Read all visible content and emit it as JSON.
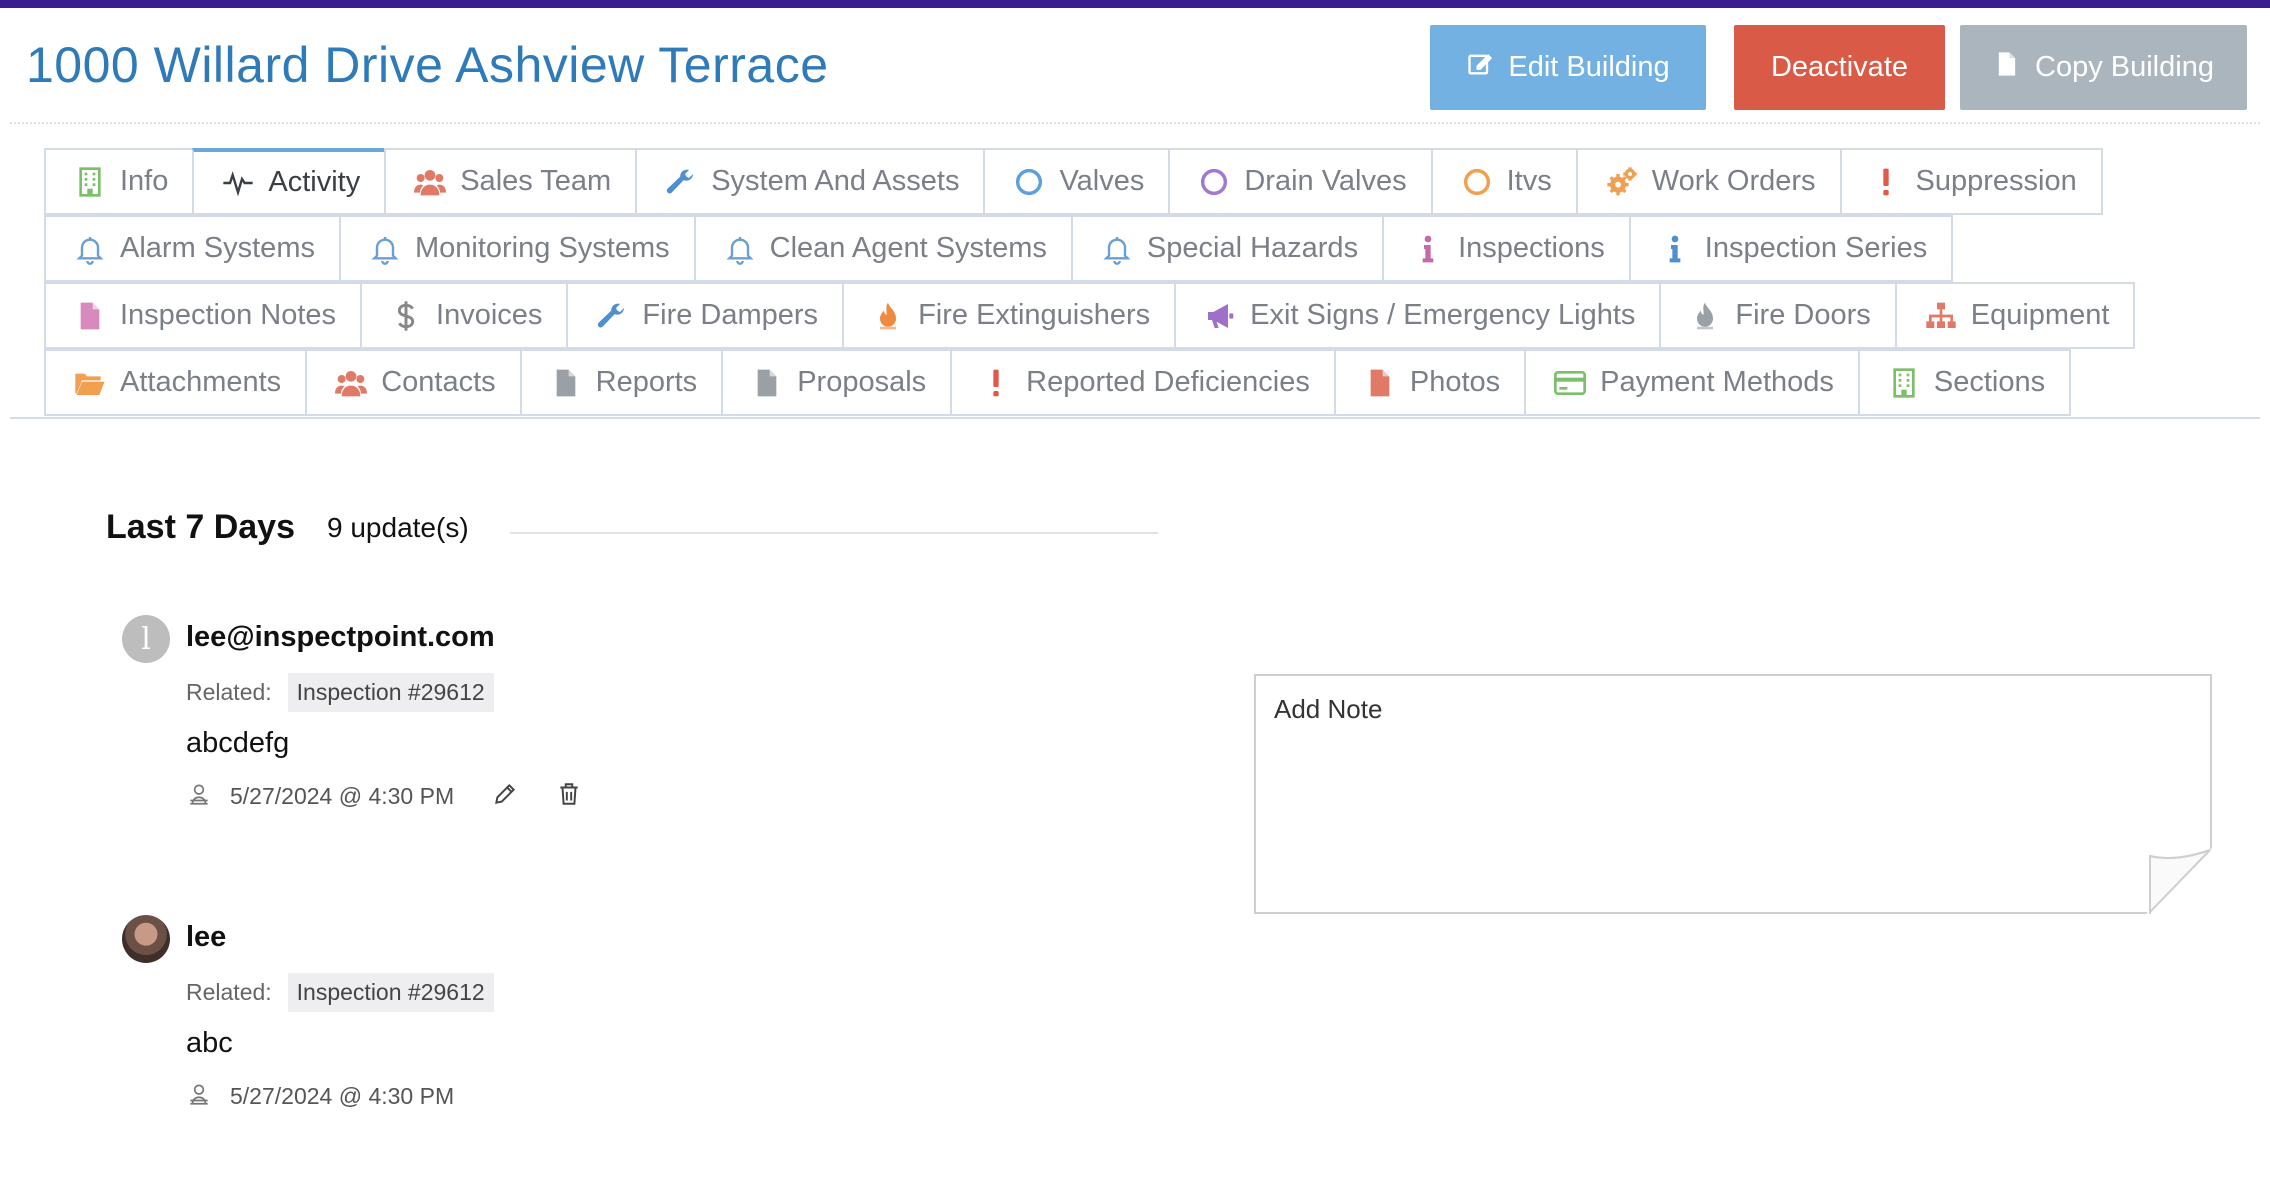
{
  "header": {
    "title": "1000 Willard Drive Ashview Terrace",
    "buttons": {
      "edit": "Edit Building",
      "deactivate": "Deactivate",
      "copy": "Copy Building"
    }
  },
  "tabs": {
    "rows": [
      [
        {
          "label": "Info",
          "icon": "building-icon",
          "color": "#7cbf6b"
        },
        {
          "label": "Activity",
          "icon": "pulse-icon",
          "color": "#3a3f45",
          "active": true
        },
        {
          "label": "Sales Team",
          "icon": "users-icon",
          "color": "#e07a66"
        },
        {
          "label": "System And Assets",
          "icon": "wrench-icon",
          "color": "#4f8fcf"
        },
        {
          "label": "Valves",
          "icon": "circle-icon",
          "color": "#5ea0dc"
        },
        {
          "label": "Drain Valves",
          "icon": "circle-icon",
          "color": "#a07ad0"
        },
        {
          "label": "Itvs",
          "icon": "circle-icon",
          "color": "#f0a050"
        },
        {
          "label": "Work Orders",
          "icon": "cogs-icon",
          "color": "#f0a050"
        },
        {
          "label": "Suppression",
          "icon": "exclamation-icon",
          "color": "#e05a4a"
        }
      ],
      [
        {
          "label": "Alarm Systems",
          "icon": "bell-icon",
          "color": "#6a9fd6"
        },
        {
          "label": "Monitoring Systems",
          "icon": "bell-icon",
          "color": "#6a9fd6"
        },
        {
          "label": "Clean Agent Systems",
          "icon": "bell-icon",
          "color": "#6a9fd6"
        },
        {
          "label": "Special Hazards",
          "icon": "bell-icon",
          "color": "#6a9fd6"
        },
        {
          "label": "Inspections",
          "icon": "info-icon",
          "color": "#c56aa8"
        },
        {
          "label": "Inspection Series",
          "icon": "info-icon",
          "color": "#4f8fcf"
        }
      ],
      [
        {
          "label": "Inspection Notes",
          "icon": "file-icon",
          "color": "#d78bbd"
        },
        {
          "label": "Invoices",
          "icon": "dollar-icon",
          "color": "#888888"
        },
        {
          "label": "Fire Dampers",
          "icon": "wrench-icon",
          "color": "#4f8fcf"
        },
        {
          "label": "Fire Extinguishers",
          "icon": "flame-icon",
          "color": "#f08a40"
        },
        {
          "label": "Exit Signs / Emergency Lights",
          "icon": "bullhorn-icon",
          "color": "#a070c8"
        },
        {
          "label": "Fire Doors",
          "icon": "flame-icon",
          "color": "#9aa0a6"
        },
        {
          "label": "Equipment",
          "icon": "sitemap-icon",
          "color": "#e07a66"
        }
      ],
      [
        {
          "label": "Attachments",
          "icon": "folder-open-icon",
          "color": "#f0a050"
        },
        {
          "label": "Contacts",
          "icon": "users-icon",
          "color": "#e07a66"
        },
        {
          "label": "Reports",
          "icon": "file-icon",
          "color": "#9aa0a6"
        },
        {
          "label": "Proposals",
          "icon": "file-icon",
          "color": "#9aa0a6"
        },
        {
          "label": "Reported Deficiencies",
          "icon": "exclamation-icon",
          "color": "#e05a4a"
        },
        {
          "label": "Photos",
          "icon": "file-icon",
          "color": "#e07a66"
        },
        {
          "label": "Payment Methods",
          "icon": "credit-card-icon",
          "color": "#7cbf6b"
        },
        {
          "label": "Sections",
          "icon": "building-icon",
          "color": "#7cbf6b"
        }
      ]
    ]
  },
  "activity": {
    "section_title": "Last 7 Days",
    "count_text": "9 update(s)",
    "entries": [
      {
        "avatar_letter": "l",
        "user": "lee@inspectpoint.com",
        "related_label": "Related:",
        "related_value": "Inspection #29612",
        "body": "abcdefg",
        "timestamp": "5/27/2024 @ 4:30 PM"
      },
      {
        "user": "lee",
        "related_label": "Related:",
        "related_value": "Inspection #29612",
        "body": "abc",
        "timestamp": "5/27/2024 @ 4:30 PM"
      }
    ]
  },
  "note": {
    "placeholder": "Add Note"
  }
}
